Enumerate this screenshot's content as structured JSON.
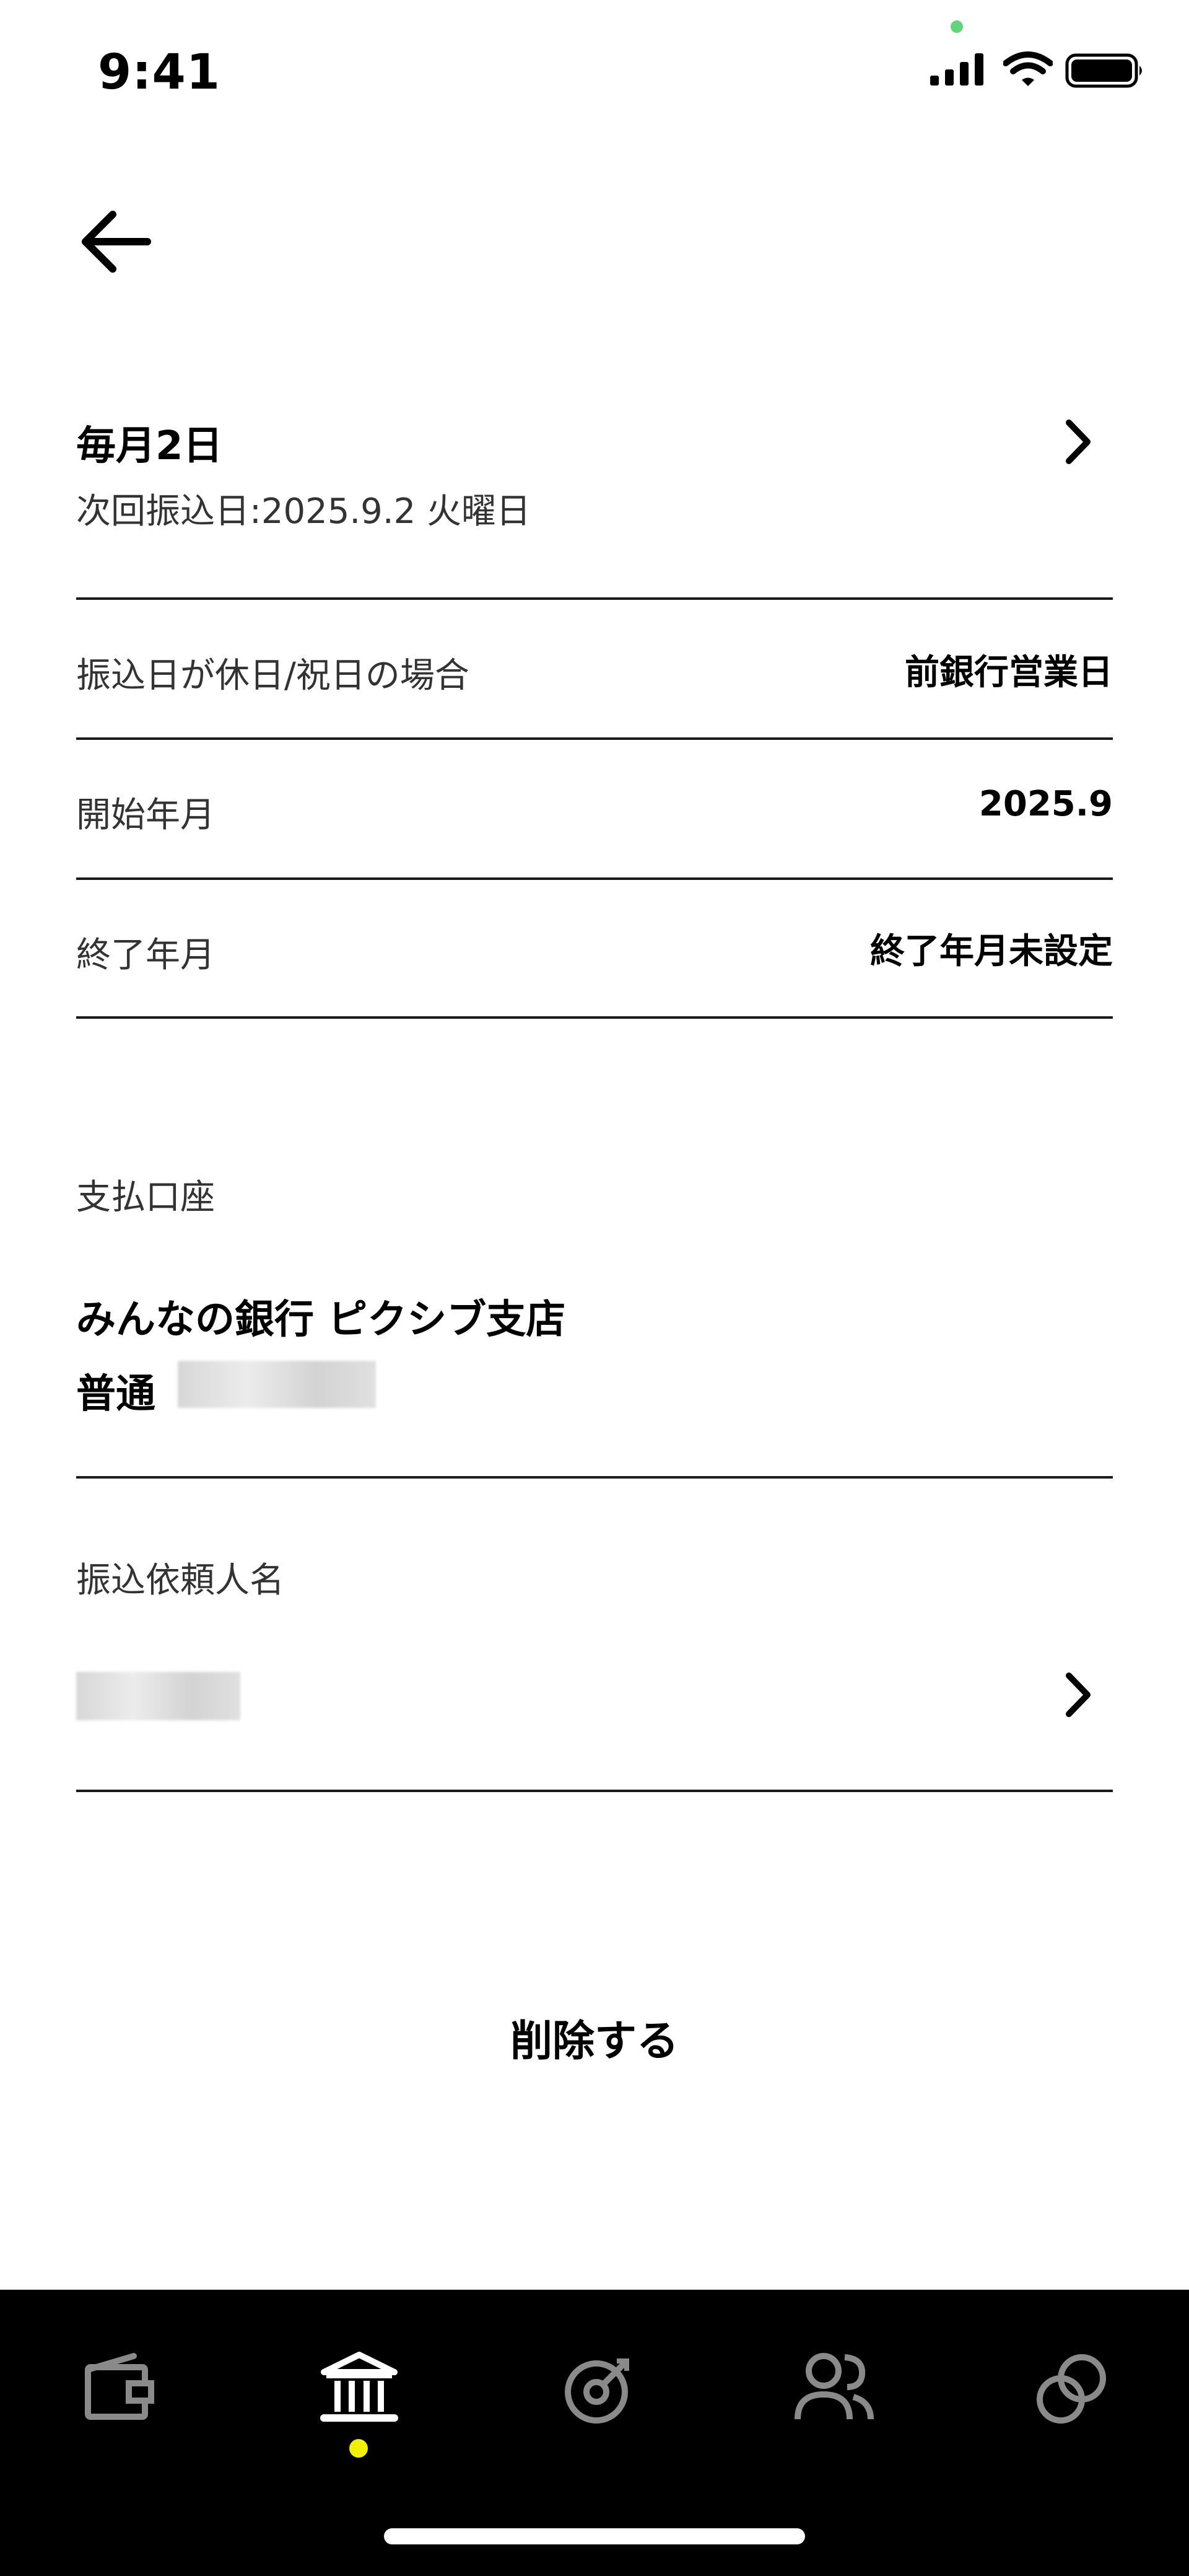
{
  "status_bar": {
    "time": "9:41"
  },
  "schedule": {
    "title": "毎月2日",
    "next_transfer": "次回振込日:2025.9.2 火曜日"
  },
  "settings": [
    {
      "label": "振込日が休日/祝日の場合",
      "value": "前銀行営業日"
    },
    {
      "label": "開始年月",
      "value": "2025.9"
    },
    {
      "label": "終了年月",
      "value": "終了年月未設定"
    }
  ],
  "payment_account": {
    "section_label": "支払口座",
    "bank_name": "みんなの銀行 ピクシブ支店",
    "account_type": "普通"
  },
  "requester": {
    "section_label": "振込依頼人名"
  },
  "actions": {
    "delete_label": "削除する"
  },
  "tabbar": {
    "tabs": [
      {
        "icon": "wallet-icon"
      },
      {
        "icon": "bank-icon",
        "active": true
      },
      {
        "icon": "target-icon"
      },
      {
        "icon": "people-icon"
      },
      {
        "icon": "link-icon"
      }
    ],
    "active_color": "#f0f000",
    "inactive_color": "#8a8a8a"
  }
}
